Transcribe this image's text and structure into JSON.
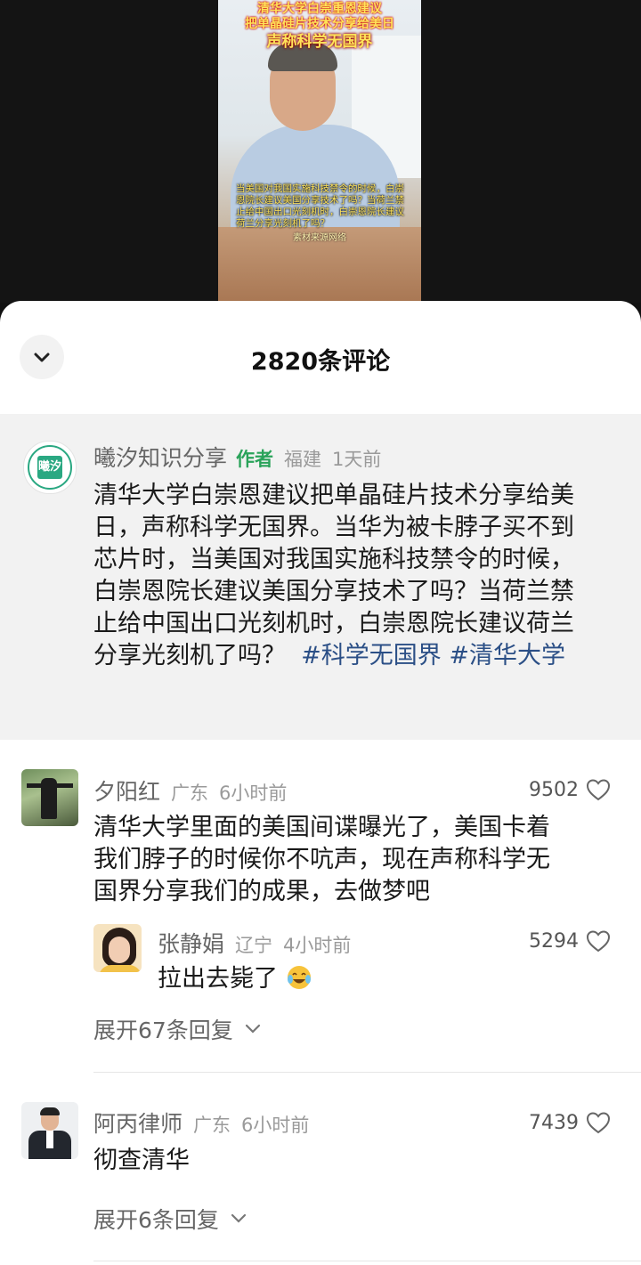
{
  "video": {
    "headline_line1": "清华大学白崇重恩建议",
    "headline_line2": "把单晶硅片技术分享给美日",
    "headline_line3": "声称科学无国界",
    "subtitle": "当美国对我国实施科技禁令的时候，白崇恩院长建议美国分享技术了吗？当荷兰禁止给中国出口光刻机时，白崇恩院长建议荷兰分享光刻机了吗？",
    "source": "素材来源网络"
  },
  "sheet": {
    "title": "2820条评论",
    "collapse_icon": "chevron-down-icon"
  },
  "pinned_comment": {
    "avatar_text": "曦汐",
    "username": "曦汐知识分享",
    "author_tag": "作者",
    "location": "福建",
    "time": "1天前",
    "text_line1": "清华大学白崇恩建议把单晶硅片技术分享给美",
    "text_line2": "日，声称科学无国界。当华为被卡脖子买不到",
    "text_line3": "芯片时，当美国对我国实施科技禁令的时候，",
    "text_line4": "白崇恩院长建议美国分享技术了吗？当荷兰禁",
    "text_line5": "止给中国出口光刻机时，白崇恩院长建议荷兰",
    "text_line6": "分享光刻机了吗？",
    "hashtag1": "#科学无国界",
    "hashtag2": "#清华大学"
  },
  "comments": [
    {
      "username": "夕阳红",
      "location": "广东",
      "time": "6小时前",
      "likes": "9502",
      "text_line1": "清华大学里面的美国间谍曝光了，美国卡着",
      "text_line2": "我们脖子的时候你不吭声，现在声称科学无",
      "text_line3": "国界分享我们的成果，去做梦吧",
      "reply": {
        "username": "张静娟",
        "location": "辽宁",
        "time": "4小时前",
        "likes": "5294",
        "text": "拉出去毙了"
      },
      "expand_label": "展开67条回复"
    },
    {
      "username": "阿丙律师",
      "location": "广东",
      "time": "6小时前",
      "likes": "7439",
      "text_line1": "彻查清华",
      "expand_label": "展开6条回复"
    }
  ],
  "colors": {
    "author_tag": "#2aa35a",
    "hashtag": "#2b4f86",
    "pinned_bg": "#f2f2f2"
  }
}
